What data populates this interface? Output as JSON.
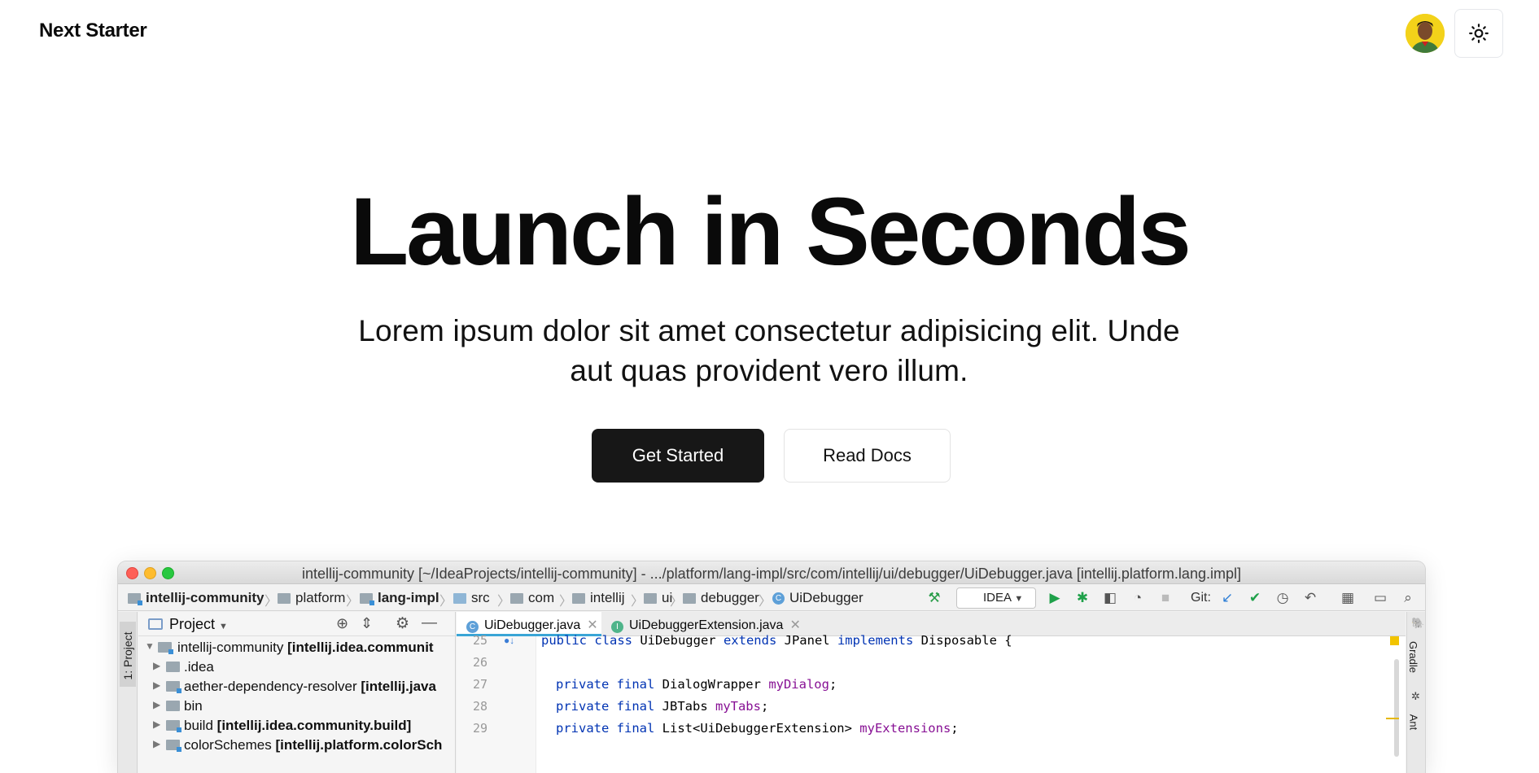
{
  "header": {
    "brand": "Next Starter",
    "avatar_label": "avatar",
    "theme_toggle_icon": "sun-icon"
  },
  "hero": {
    "title": "Launch in Seconds",
    "subtitle_line1": "Lorem ipsum dolor sit amet consectetur adipisicing elit. Unde",
    "subtitle_line2": "aut quas provident vero illum.",
    "primary_button": "Get Started",
    "secondary_button": "Read Docs"
  },
  "ide": {
    "window_title": "intellij-community [~/IdeaProjects/intellij-community] - .../platform/lang-impl/src/com/intellij/ui/debugger/UiDebugger.java [intellij.platform.lang.impl]",
    "breadcrumbs": [
      "intellij-community",
      "platform",
      "lang-impl",
      "src",
      "com",
      "intellij",
      "ui",
      "debugger",
      "UiDebugger"
    ],
    "run_config": "IDEA",
    "git_label": "Git:",
    "left_strip_label": "1: Project",
    "project_pane_title": "Project",
    "tree": [
      {
        "name": "intellij-community",
        "module": "[intellij.idea.communit"
      },
      {
        "name": ".idea",
        "module": ""
      },
      {
        "name": "aether-dependency-resolver",
        "module": "[intellij.java"
      },
      {
        "name": "bin",
        "module": ""
      },
      {
        "name": "build",
        "module": "[intellij.idea.community.build]"
      },
      {
        "name": "colorSchemes",
        "module": "[intellij.platform.colorSch"
      }
    ],
    "tabs": [
      "UiDebugger.java",
      "UiDebuggerExtension.java"
    ],
    "line_numbers": [
      "25",
      "26",
      "27",
      "28",
      "29"
    ],
    "code": {
      "l25_a": "public class",
      "l25_b": " UiDebugger ",
      "l25_c": "extends",
      "l25_d": " JPanel ",
      "l25_e": "implements",
      "l25_f": " Disposable {",
      "l27_kw": "private final",
      "l27_type": " DialogWrapper ",
      "l27_field": "myDialog",
      "l28_kw": "private final",
      "l28_type": " JBTabs ",
      "l28_field": "myTabs",
      "l29_kw": "private final",
      "l29_type": " List<UiDebuggerExtension> ",
      "l29_field": "myExtensions",
      "semi": ";"
    },
    "right_strip": [
      "Gradle",
      "Ant"
    ]
  }
}
